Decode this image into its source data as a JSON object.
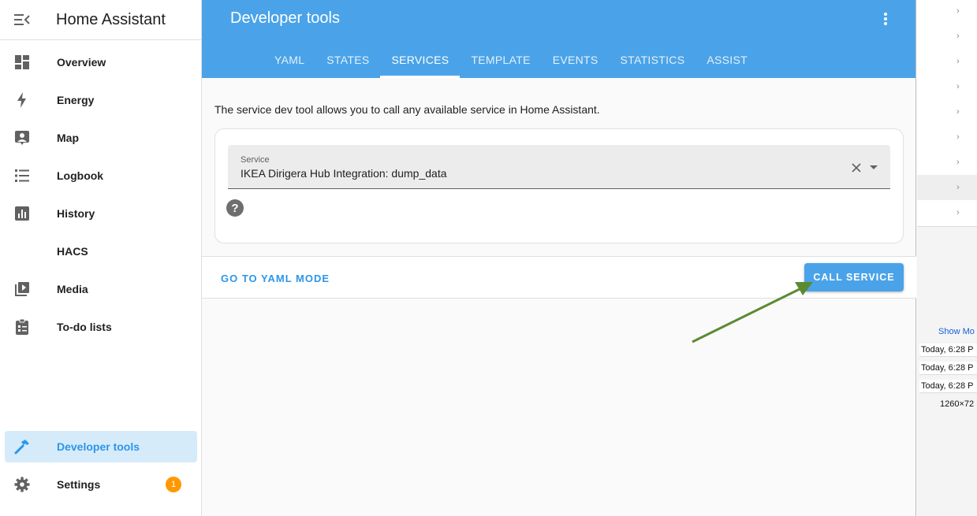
{
  "sidebar": {
    "app_title": "Home Assistant",
    "items": [
      {
        "label": "Overview",
        "icon": "dashboard-icon"
      },
      {
        "label": "Energy",
        "icon": "lightning-icon"
      },
      {
        "label": "Map",
        "icon": "map-icon"
      },
      {
        "label": "Logbook",
        "icon": "list-icon"
      },
      {
        "label": "History",
        "icon": "chart-icon"
      },
      {
        "label": "HACS",
        "icon": ""
      },
      {
        "label": "Media",
        "icon": "media-icon"
      },
      {
        "label": "To-do lists",
        "icon": "clipboard-icon"
      }
    ],
    "developer_tools": "Developer tools",
    "settings": "Settings",
    "settings_badge": "1"
  },
  "header": {
    "title": "Developer tools",
    "tabs": [
      "YAML",
      "STATES",
      "SERVICES",
      "TEMPLATE",
      "EVENTS",
      "STATISTICS",
      "ASSIST"
    ],
    "active_tab": "SERVICES"
  },
  "main": {
    "intro": "The service dev tool allows you to call any available service in Home Assistant.",
    "service_label": "Service",
    "service_value": "IKEA Dirigera Hub Integration: dump_data",
    "yaml_mode": "GO TO YAML MODE",
    "call_service": "CALL SERVICE"
  },
  "background_window": {
    "show_more": "Show Mo",
    "rows": [
      "Today, 6:28 P",
      "Today, 6:28 P",
      "Today, 6:28 P"
    ],
    "dimensions": "1260×72"
  },
  "colors": {
    "accent": "#4aa3e8",
    "active_item_bg": "#d6ebfa",
    "badge": "#ff9800",
    "annotation_arrow": "#5b8a33"
  }
}
